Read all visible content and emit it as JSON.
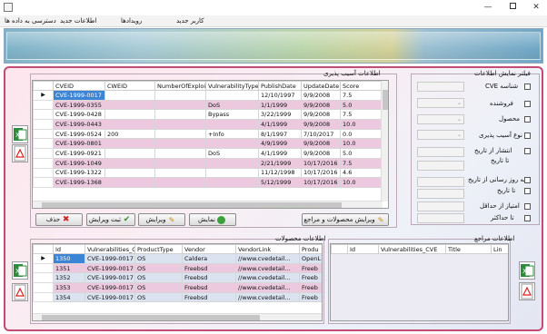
{
  "menu": {
    "items": [
      "کاربر جدید",
      "رویدادها",
      "اطلاعات جدید",
      "دسترسی به داده ها"
    ]
  },
  "vuln_panel": {
    "title": "اطلاعات آسیب پذیری",
    "columns": [
      "CVEID",
      "CWEID",
      "NumberOfExploits",
      "VulnerabilityTypes",
      "PublishDate",
      "UpdateDate",
      "Score"
    ],
    "rows": [
      [
        "CVE-1999-0017",
        "",
        "",
        "",
        "12/10/1997",
        "9/9/2008",
        "7.5"
      ],
      [
        "CVE-1999-0355",
        "",
        "",
        "DoS",
        "1/1/1999",
        "9/9/2008",
        "5.0"
      ],
      [
        "CVE-1999-0428",
        "",
        "",
        "Bypass",
        "3/22/1999",
        "9/9/2008",
        "7.5"
      ],
      [
        "CVE-1999-0443",
        "",
        "",
        "",
        "4/1/1999",
        "9/9/2008",
        "10.0"
      ],
      [
        "CVE-1999-0524",
        "200",
        "",
        "+Info",
        "8/1/1997",
        "7/10/2017",
        "0.0"
      ],
      [
        "CVE-1999-0801",
        "",
        "",
        "",
        "4/9/1999",
        "9/9/2008",
        "10.0"
      ],
      [
        "CVE-1999-0921",
        "",
        "",
        "DoS",
        "4/1/1999",
        "9/9/2008",
        "5.0"
      ],
      [
        "CVE-1999-1049",
        "",
        "",
        "",
        "2/21/1999",
        "10/17/2016",
        "7.5"
      ],
      [
        "CVE-1999-1322",
        "",
        "",
        "",
        "11/12/1998",
        "10/17/2016",
        "4.6"
      ],
      [
        "CVE-1999-1368",
        "",
        "",
        "",
        "5/12/1999",
        "10/17/2016",
        "10.0"
      ]
    ]
  },
  "filters": {
    "title": "فیلتر نمایش اطلاعات",
    "items": [
      "شناسه CVE",
      "فروشنده",
      "محصول",
      "نوع آسیب پذیری",
      "انتشار از تاریخ",
      "تا تاریخ",
      "به روز رسانی از تاریخ",
      "تا تاریخ",
      "امتیاز از حداقل",
      "تا حداکثر"
    ]
  },
  "buttons": {
    "edit_products_refs": "ویرایش محصولات و مراجع",
    "show": "نمایش",
    "edit": "ویرایش",
    "save_edit": "ثبت ویرایش",
    "delete": "حذف"
  },
  "products_panel": {
    "title": "اطلاعات محصولات",
    "columns": [
      "Id",
      "Vulnerabilities_CVE",
      "ProductType",
      "Vendor",
      "VendorLink",
      "Produ"
    ],
    "rows": [
      [
        "1350",
        "CVE-1999-0017",
        "OS",
        "Caldera",
        "//www.cvedetail...",
        "OpenL"
      ],
      [
        "1351",
        "CVE-1999-0017",
        "OS",
        "Freebsd",
        "//www.cvedetail...",
        "Freeb"
      ],
      [
        "1352",
        "CVE-1999-0017",
        "OS",
        "Freebsd",
        "//www.cvedetail...",
        "Freeb"
      ],
      [
        "1353",
        "CVE-1999-0017",
        "OS",
        "Freebsd",
        "//www.cvedetail...",
        "Freeb"
      ],
      [
        "1354",
        "CVE-1999-0017",
        "OS",
        "Freebsd",
        "//www.cvedetail...",
        "Freeb"
      ]
    ]
  },
  "refs_panel": {
    "title": "اطلاعات مراجع",
    "columns": [
      "Id",
      "Vulnerabilities_CVE",
      "Title",
      "Lin"
    ]
  },
  "colors": {
    "accent": "#c34c74",
    "selected": "#3c84d5",
    "row_blue": "#dbe3f1",
    "row_pink": "#ecc9de"
  },
  "icons": [
    "excel-icon",
    "pdf-icon",
    "show-icon",
    "edit-icon",
    "save-icon",
    "delete-icon"
  ]
}
